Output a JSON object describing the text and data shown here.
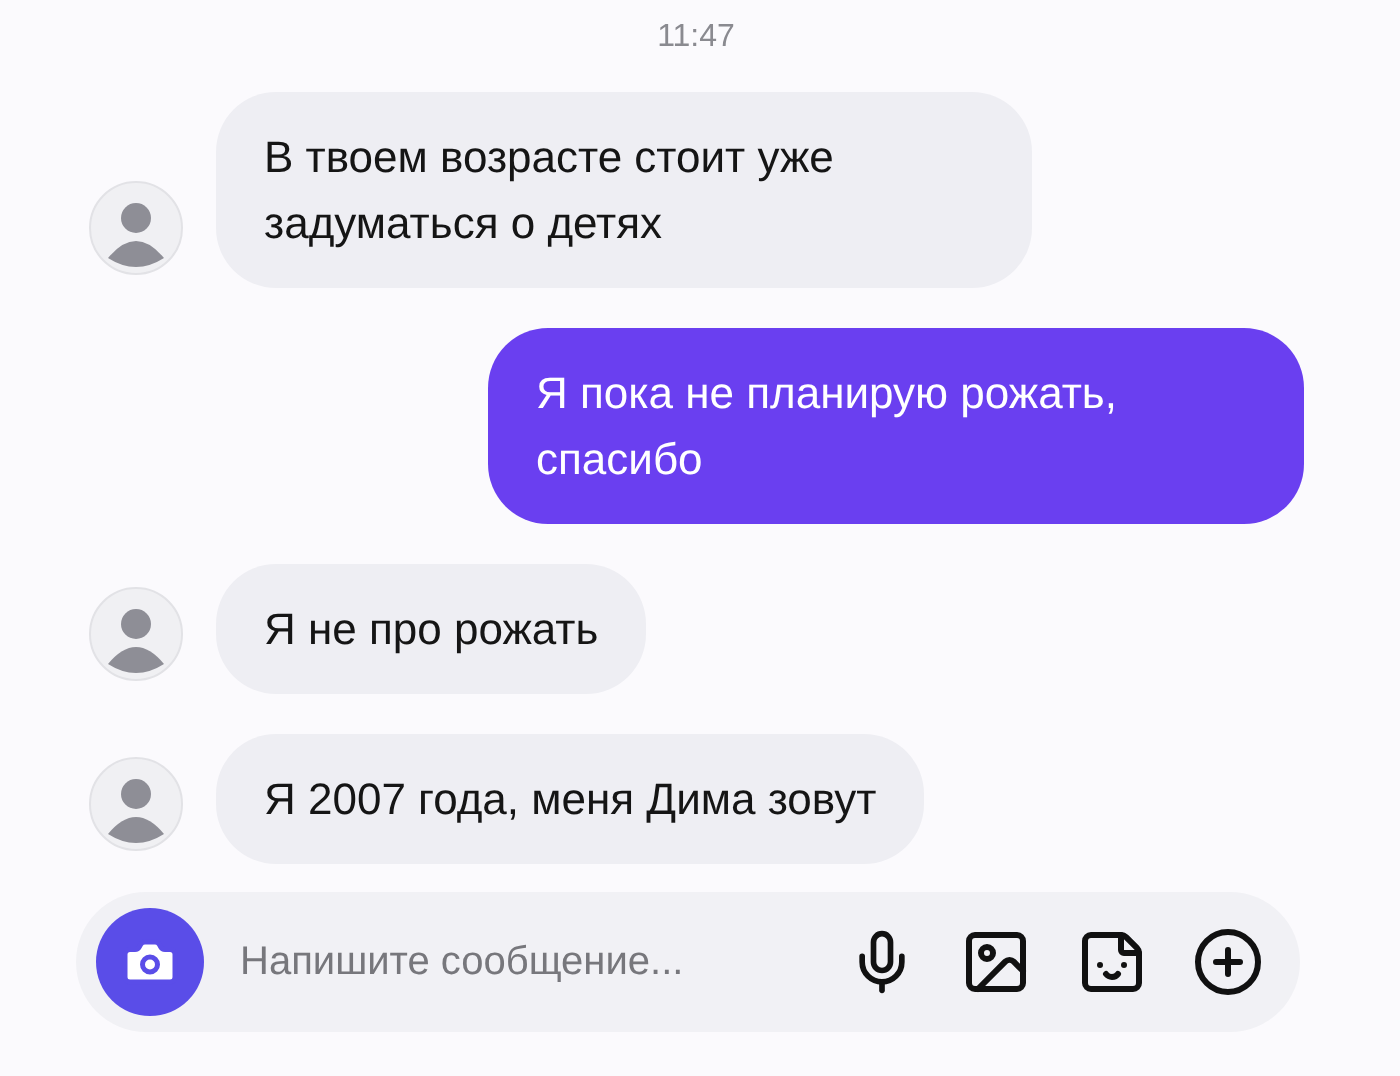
{
  "time": "11:47",
  "messages": [
    {
      "kind": "incoming",
      "text": "В твоем возрасте стоит уже задуматься о детях"
    },
    {
      "kind": "outgoing",
      "text": "Я пока не планирую рожать, спасибо"
    },
    {
      "kind": "incoming",
      "text": "Я не про рожать"
    },
    {
      "kind": "incoming",
      "text": "Я 2007 года, меня Дима зовут"
    }
  ],
  "composer": {
    "placeholder": "Напишите сообщение..."
  }
}
